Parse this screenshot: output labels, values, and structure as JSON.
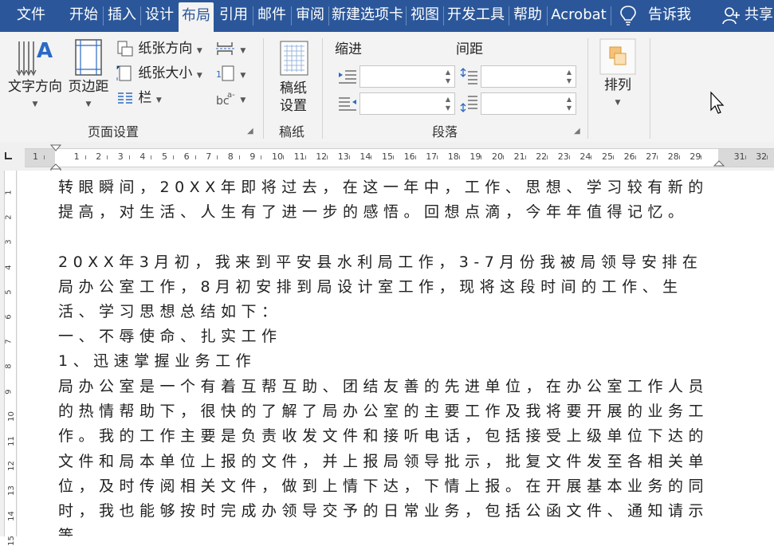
{
  "tabs": [
    "文件",
    "开始",
    "插入",
    "设计",
    "布局",
    "引用",
    "邮件",
    "审阅",
    "新建选项卡",
    "视图",
    "开发工具",
    "帮助",
    "Acrobat",
    "告诉我",
    "共享"
  ],
  "active_tab": "布局",
  "icons": {
    "tell_me": "lightbulb-icon",
    "share": "person-icon"
  },
  "ribbon": {
    "page_setup": {
      "text_direction": "文字方向",
      "margins": "页边距",
      "orientation": "纸张方向",
      "size": "纸张大小",
      "columns": "栏",
      "label": "页面设置"
    },
    "manuscript": {
      "button": [
        "稿纸",
        "设置"
      ],
      "label": "稿纸"
    },
    "paragraph": {
      "indent_title": "缩进",
      "spacing_title": "间距",
      "indent_left": "",
      "indent_right": "",
      "spacing_before": "",
      "spacing_after": "",
      "label": "段落"
    },
    "arrange": {
      "button": "排列"
    }
  },
  "ruler": {
    "numbers": [
      "1",
      "1",
      "2",
      "3",
      "4",
      "5",
      "6",
      "7",
      "8",
      "9",
      "10",
      "11",
      "12",
      "13",
      "14",
      "15",
      "16",
      "17",
      "18",
      "19",
      "20",
      "21",
      "22",
      "23",
      "24",
      "25",
      "26",
      "27",
      "28",
      "29",
      "31",
      "32"
    ],
    "vertical_numbers": [
      "1",
      "2",
      "3",
      "4",
      "5",
      "6",
      "7",
      "8",
      "9",
      "10",
      "11",
      "12",
      "13",
      "14",
      "15"
    ]
  },
  "document": {
    "paragraphs": [
      "转眼瞬间，20XX年即将过去，在这一年中，工作、思想、学习较有新的提高，对生活、人生有了进一步的感悟。回想点滴，今年年值得记忆。",
      "20XX年3月初，我来到平安县水利局工作，3-7月份我被局领导安排在局办公室工作，8月初安排到局设计室工作，现将这段时间的工作、生活、学习思想总结如下：",
      "一、不辱使命、扎实工作",
      "1、迅速掌握业务工作",
      "局办公室是一个有着互帮互助、团结友善的先进单位，在办公室工作人员的热情帮助下，很快的了解了局办公室的主要工作及我将要开展的业务工作。我的工作主要是负责收发文件和接听电话，包括接受上级单位下达的文件和局本单位上报的文件，并上报局领导批示，批复文件发至各相关单位，及时传阅相关文件，做到上情下达，下情上报。在开展基本业务的同时，我也能够按时完成办领导交予的日常业务，包括公函文件、通知请示等。"
    ]
  },
  "colors": {
    "accent": "#2b579a",
    "ribbon_bg": "#f3f3f3"
  }
}
